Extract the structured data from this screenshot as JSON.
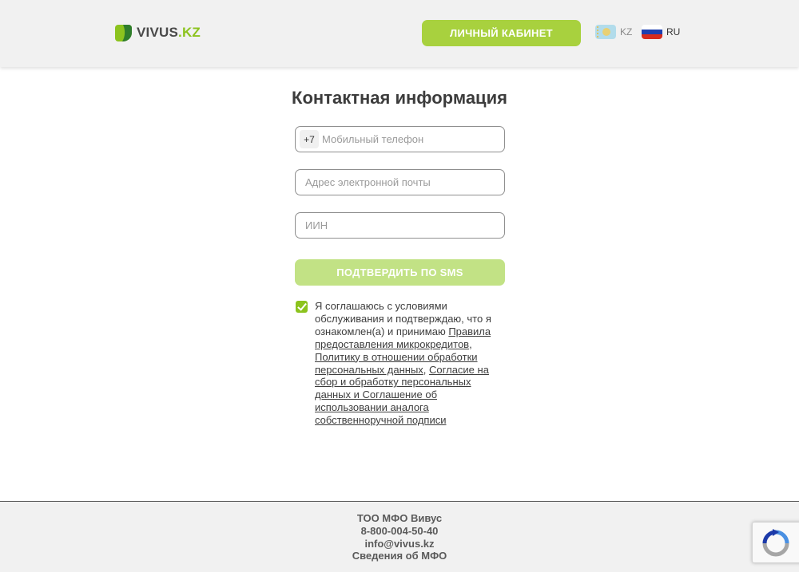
{
  "header": {
    "logo": {
      "part1": "VIVUS",
      "part2": ".KZ"
    },
    "cabinet_button": "ЛИЧНЫЙ КАБИНЕТ",
    "languages": [
      {
        "code": "KZ",
        "active": false
      },
      {
        "code": "RU",
        "active": true
      }
    ]
  },
  "form": {
    "title": "Контактная информация",
    "phone": {
      "prefix": "+7",
      "placeholder": "Мобильный телефон",
      "value": ""
    },
    "email": {
      "placeholder": "Адрес электронной почты",
      "value": ""
    },
    "iin": {
      "placeholder": "ИИН",
      "value": ""
    },
    "submit_label": "ПОДТВЕРДИТЬ ПО SMS",
    "agreement": {
      "checked": true,
      "text_before": "Я соглашаюсь с условиями обслуживания и подтверждаю, что я ознакомлен(а) и принимаю ",
      "link1": "Правила предоставления микрокредитов",
      "sep1": ", ",
      "link2": "Политику в отношении обработки персональных данных",
      "sep2": ", ",
      "link3": "Согласие на сбор и обработку персональных данных и Соглашение об использовании аналога собственноручной подписи"
    }
  },
  "footer": {
    "company": "ТОО МФО Вивус",
    "phone": "8-800-004-50-40",
    "email": "info@vivus.kz",
    "info_link": "Сведения об МФО"
  },
  "colors": {
    "brand_green": "#8cc31e",
    "button_green": "#a8d13e",
    "button_disabled": "#c2e285",
    "header_bg": "#f1f1f1"
  }
}
